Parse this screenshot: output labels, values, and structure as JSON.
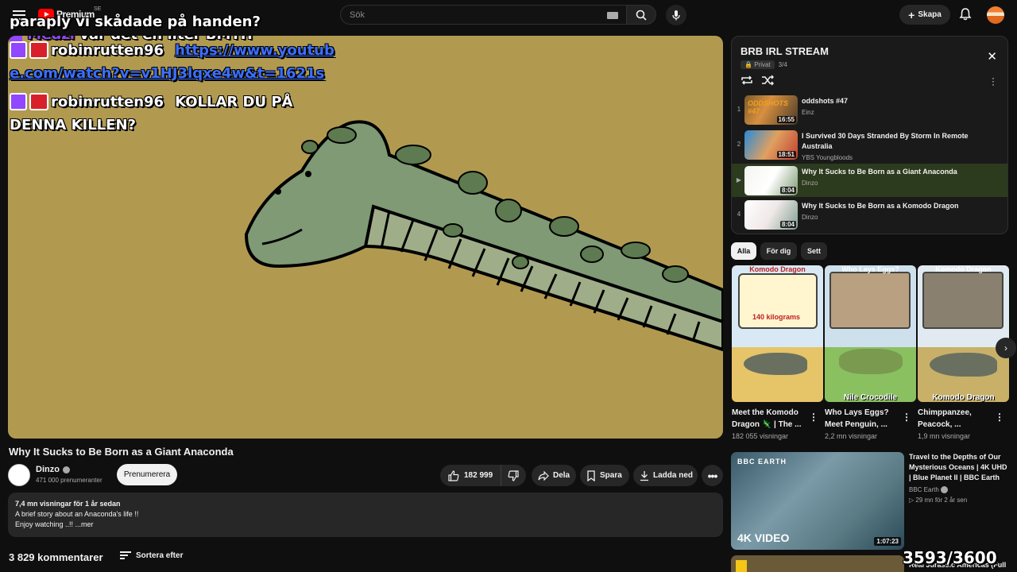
{
  "header": {
    "logo_text": "Premium",
    "country": "SE",
    "search_placeholder": "Sök",
    "create_label": "Skapa"
  },
  "overlay": {
    "top_line_name": "Medzi",
    "top_line_text": "var det en liter BMTH",
    "line2": "paraply vi skådade på handen?",
    "chat": [
      {
        "user": "robinrutten96",
        "message_a": "https://www.youtub",
        "message_b": "e.com/watch?v=v1HJ3lqxe4w&t=1621s"
      },
      {
        "user": "robinrutten96",
        "message_a": "KOLLAR DU PÅ",
        "message_b": "DENNA KILLEN?"
      }
    ],
    "counter": "3593/3600"
  },
  "video": {
    "title": "Why It Sucks to Be Born as a Giant Anaconda",
    "channel": "Dinzo",
    "subscribers": "471 000 prenumeranter",
    "subscribe_label": "Prenumerera",
    "likes": "182 999",
    "share_label": "Dela",
    "save_label": "Spara",
    "download_label": "Ladda ned",
    "desc_meta": "7,4 mn visningar  för 1 år sedan",
    "desc_line1": "A brief story about an Anaconda's life !!",
    "desc_line2": "Enjoy watching ..!! ...mer",
    "comments": "3 829 kommentarer",
    "sort_label": "Sortera efter"
  },
  "playlist": {
    "title": "BRB IRL STREAM",
    "privacy": "Privat",
    "position": "3/4",
    "items": [
      {
        "index": "1",
        "title": "oddshots #47",
        "channel": "Einz",
        "duration": "16:55"
      },
      {
        "index": "2",
        "title": "I Survived 30 Days Stranded By Storm In Remote Australia",
        "channel": "YBS Youngbloods",
        "duration": "18:51"
      },
      {
        "index": "▶",
        "title": "Why It Sucks to Be Born as a Giant Anaconda",
        "channel": "Dinzo",
        "duration": "8:04"
      },
      {
        "index": "4",
        "title": "Why It Sucks to Be Born as a Komodo Dragon",
        "channel": "Dinzo",
        "duration": "8:04"
      }
    ]
  },
  "chips": [
    "Alla",
    "För dig",
    "Sett"
  ],
  "shelf": [
    {
      "title": "Meet the Komodo Dragon 🦎 | The ...",
      "views": "182 055 visningar",
      "thumb_top": "Komodo Dragon",
      "thumb_text": "140 kilograms"
    },
    {
      "title": "Who Lays Eggs? Meet Penguin, ...",
      "views": "2,2 mn visningar",
      "thumb_top": "Who Lays Eggs?",
      "thumb_text": "Nile Crocodile"
    },
    {
      "title": "Chimppanzee, Peacock, ...",
      "views": "1,9 mn visningar",
      "thumb_top": "Komodo Dragon",
      "thumb_text": "Komodo Dragon"
    }
  ],
  "recommended": [
    {
      "title": "Travel to the Depths of Our Mysterious Oceans | 4K UHD | Blue Planet II | BBC Earth",
      "channel": "BBC Earth",
      "meta": "▷ 29 mn  för 2 år sen",
      "duration": "1:07:23",
      "badge": "4K VIDEO",
      "brand": "BBC EARTH"
    },
    {
      "title": "Real Jurassic Americas (Full"
    }
  ],
  "colors": {
    "background": "#0f0f0f",
    "video_bg": "#b19a50",
    "active_item": "#2c3a1d",
    "twitch": "#9146ff",
    "link": "#3b6fff"
  }
}
